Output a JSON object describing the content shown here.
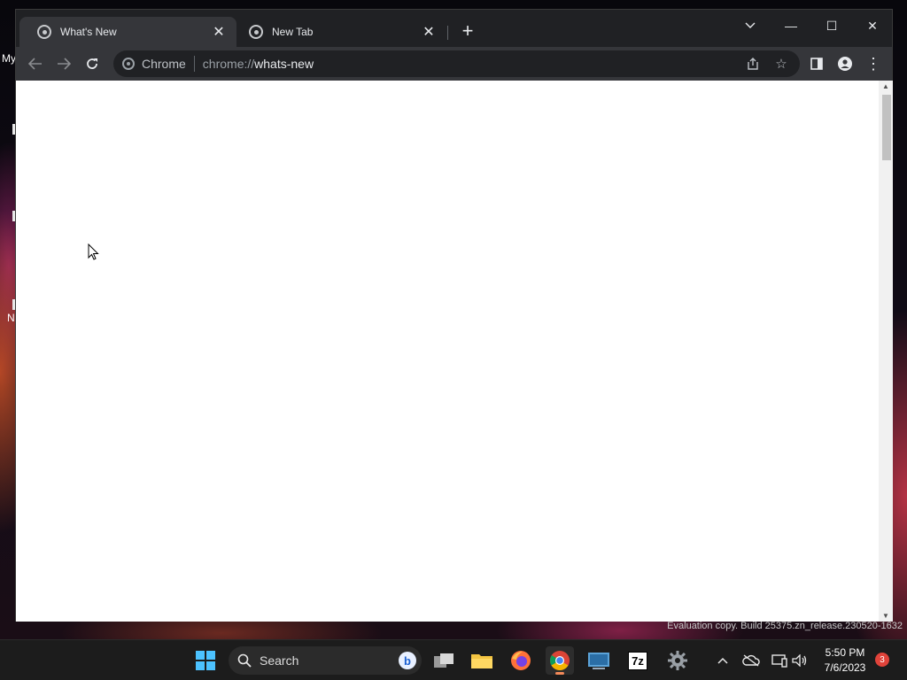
{
  "desktop": {
    "icon_labels": [
      "My",
      "N"
    ]
  },
  "browser": {
    "tabs": [
      {
        "title": "What's New",
        "active": true
      },
      {
        "title": "New Tab",
        "active": false
      }
    ],
    "new_tab_symbol": "+",
    "window_controls": {
      "minimize": "—",
      "maximize": "☐",
      "close": "✕"
    },
    "tab_search_icon": "chevron-down",
    "omnibox": {
      "chip": "Chrome",
      "scheme": "chrome://",
      "path": "whats-new"
    },
    "colors": {
      "frame": "#202124",
      "toolbar": "#35363a",
      "content": "#ffffff"
    }
  },
  "watermark": "Evaluation copy. Build 25375.zn_release.230520-1632",
  "taskbar": {
    "search_placeholder": "Search",
    "time": "5:50 PM",
    "date": "7/6/2023",
    "notification_count": "3",
    "pinned_apps": [
      "windows-start",
      "task-view",
      "file-explorer",
      "firefox",
      "chrome",
      "remote-desktop",
      "7zip",
      "settings"
    ]
  }
}
